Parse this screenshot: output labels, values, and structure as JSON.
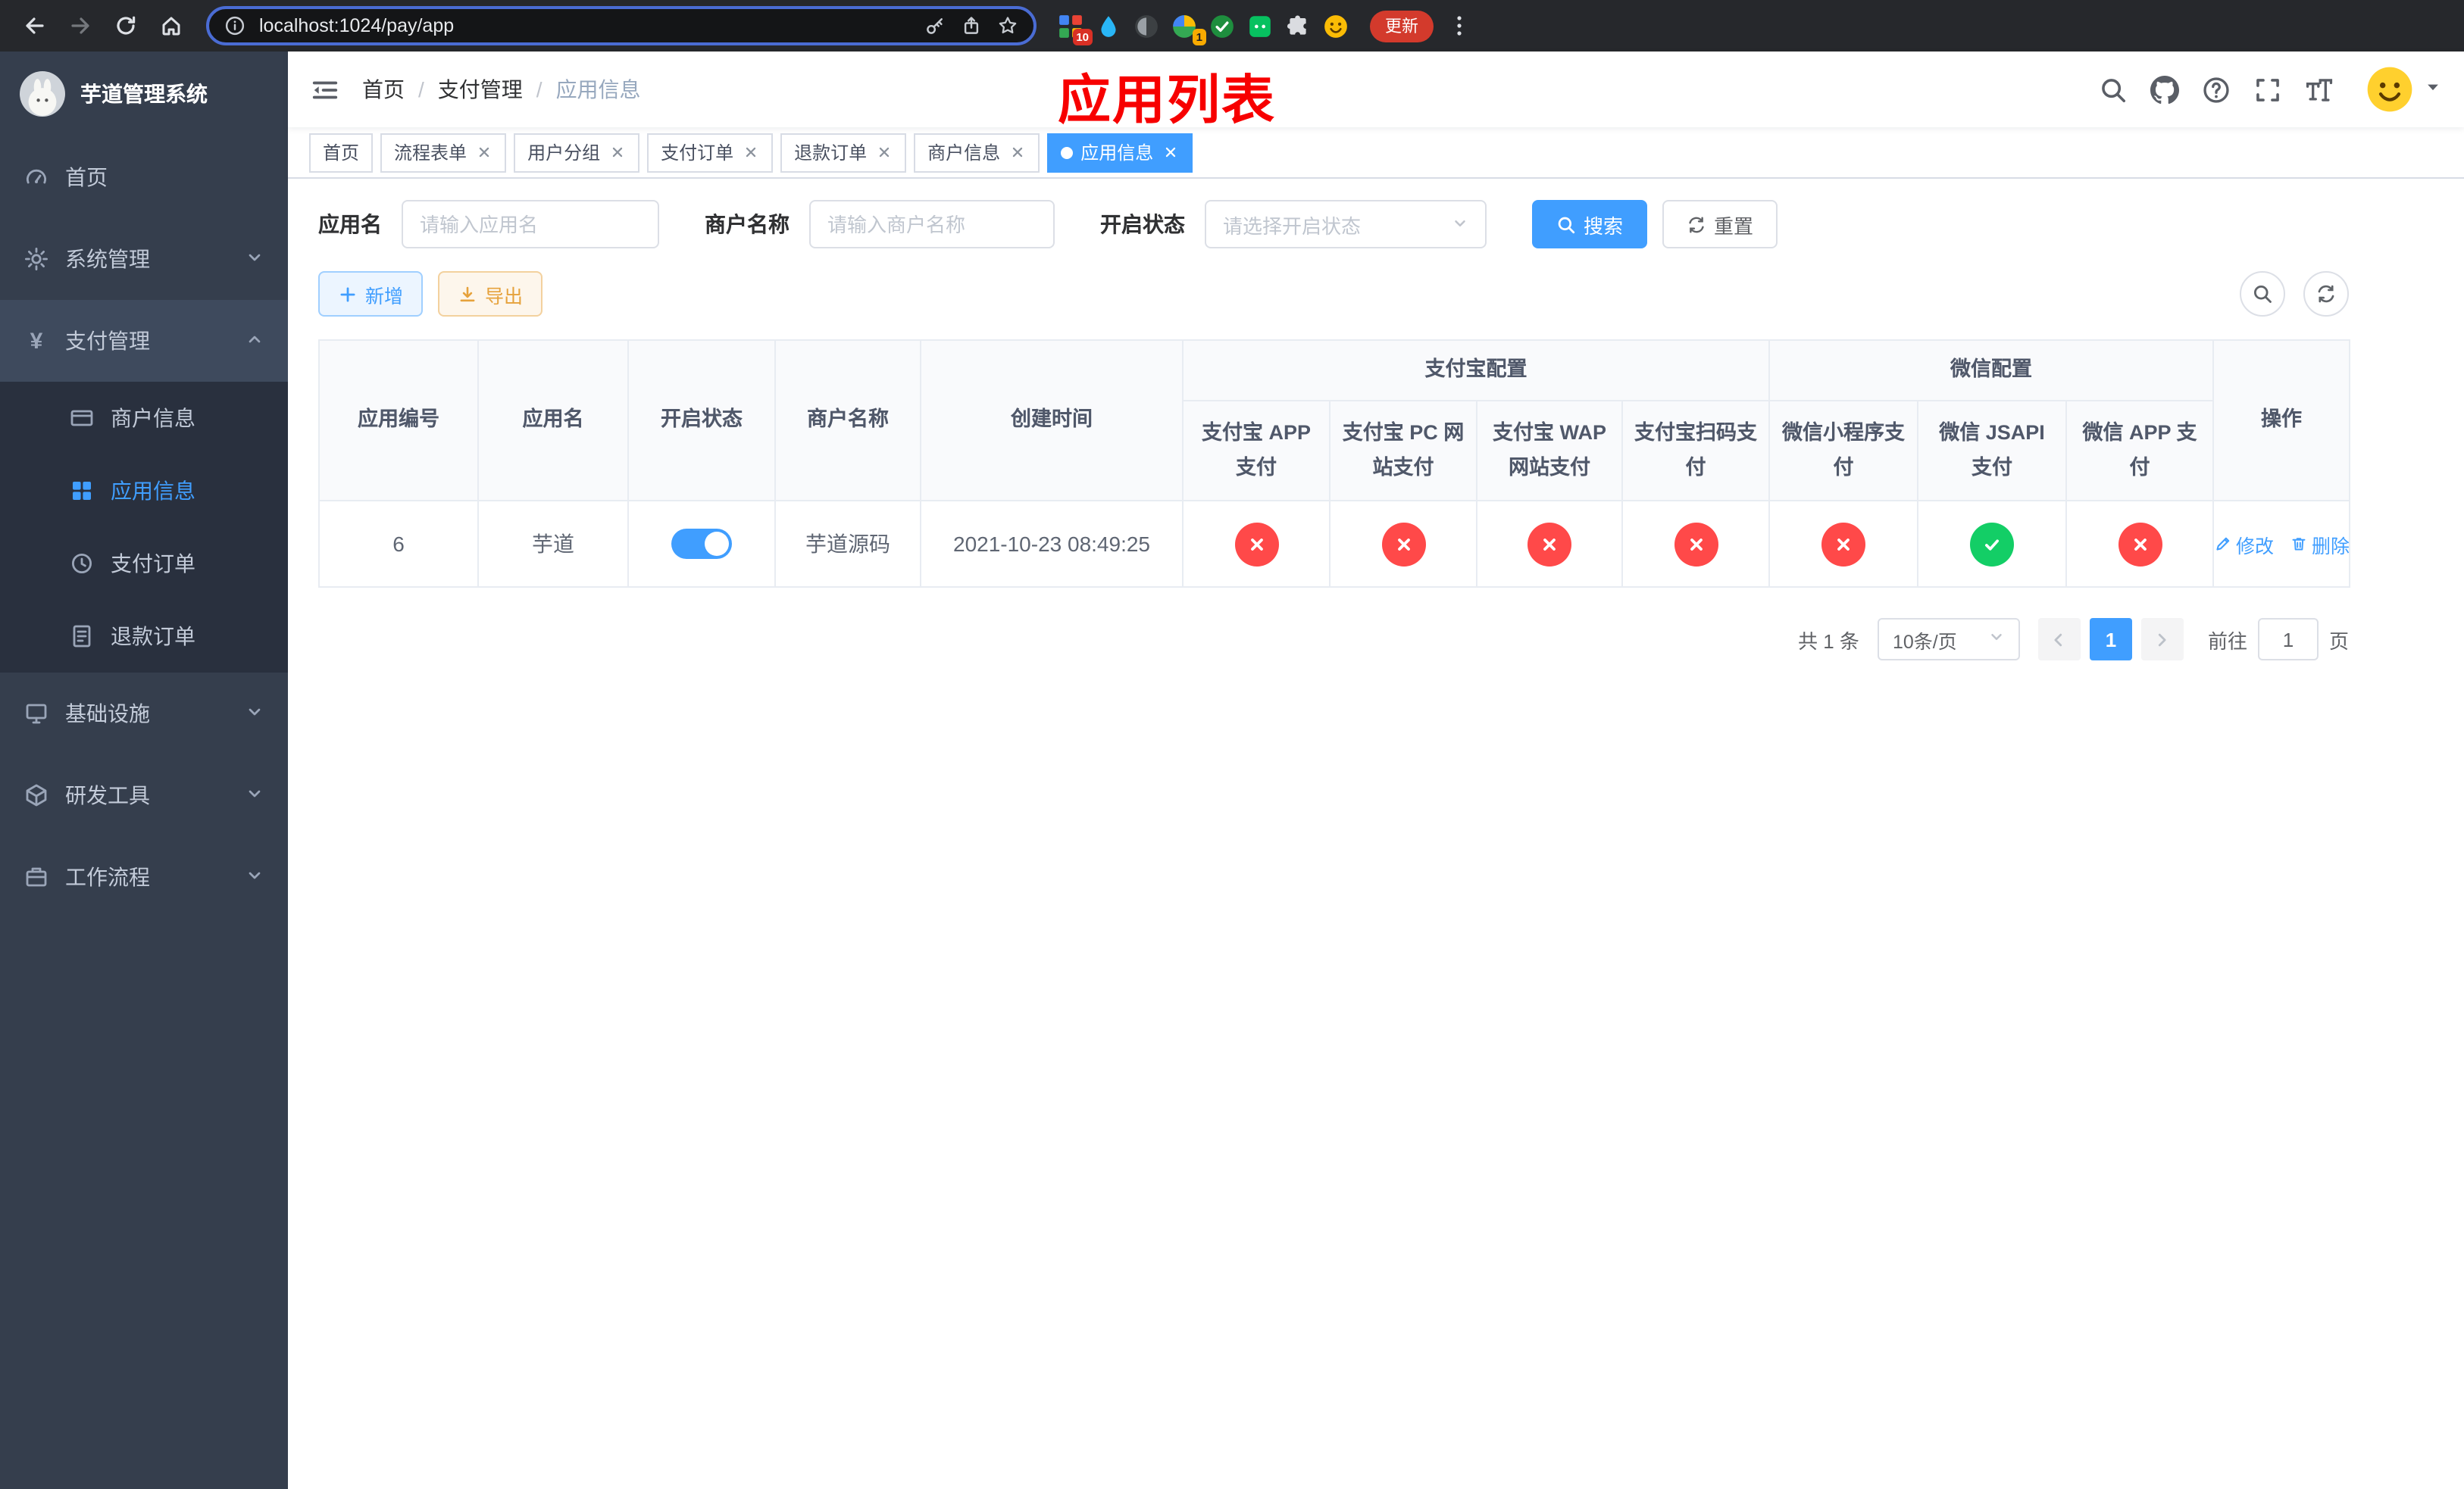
{
  "browser": {
    "url": "localhost:1024/pay/app",
    "update_label": "更新",
    "extension_badges": {
      "first": "10",
      "second": "1"
    }
  },
  "sidebar": {
    "title": "芋道管理系统",
    "items": [
      {
        "label": "首页"
      },
      {
        "label": "系统管理"
      },
      {
        "label": "支付管理"
      },
      {
        "label": "基础设施"
      },
      {
        "label": "研发工具"
      },
      {
        "label": "工作流程"
      }
    ],
    "payment_children": [
      {
        "label": "商户信息"
      },
      {
        "label": "应用信息",
        "active": true
      },
      {
        "label": "支付订单"
      },
      {
        "label": "退款订单"
      }
    ]
  },
  "navbar": {
    "breadcrumb": {
      "home": "首页",
      "section": "支付管理",
      "current": "应用信息"
    },
    "separator": "/",
    "overlay_title": "应用列表"
  },
  "tabs": {
    "items": [
      {
        "label": "首页",
        "closable": false,
        "active": false
      },
      {
        "label": "流程表单",
        "closable": true,
        "active": false
      },
      {
        "label": "用户分组",
        "closable": true,
        "active": false
      },
      {
        "label": "支付订单",
        "closable": true,
        "active": false
      },
      {
        "label": "退款订单",
        "closable": true,
        "active": false
      },
      {
        "label": "商户信息",
        "closable": true,
        "active": false
      },
      {
        "label": "应用信息",
        "closable": true,
        "active": true
      }
    ]
  },
  "filters": {
    "app_name_label": "应用名",
    "app_name_placeholder": "请输入应用名",
    "merchant_label": "商户名称",
    "merchant_placeholder": "请输入商户名称",
    "status_label": "开启状态",
    "status_placeholder": "请选择开启状态",
    "search_label": "搜索",
    "reset_label": "重置"
  },
  "toolbar": {
    "add_label": "新增",
    "export_label": "导出"
  },
  "table": {
    "col_id": "应用编号",
    "col_name": "应用名",
    "col_status": "开启状态",
    "col_merchant": "商户名称",
    "col_created": "创建时间",
    "group_alipay": "支付宝配置",
    "group_wechat": "微信配置",
    "col_alipay_app": "支付宝 APP 支付",
    "col_alipay_pc": "支付宝 PC 网站支付",
    "col_alipay_wap": "支付宝 WAP 网站支付",
    "col_alipay_qr": "支付宝扫码支付",
    "col_wx_mini": "微信小程序支付",
    "col_wx_jsapi": "微信 JSAPI 支付",
    "col_wx_app": "微信 APP 支付",
    "col_actions": "操作",
    "row": {
      "id": "6",
      "name": "芋道",
      "enabled": true,
      "merchant": "芋道源码",
      "created": "2021-10-23 08:49:25",
      "configs": {
        "alipay_app": false,
        "alipay_pc": false,
        "alipay_wap": false,
        "alipay_qr": false,
        "wx_mini": false,
        "wx_jsapi": true,
        "wx_app": false
      },
      "edit_label": "修改",
      "delete_label": "删除"
    }
  },
  "pagination": {
    "total": "共 1 条",
    "page_size": "10条/页",
    "current": "1",
    "goto_prefix": "前往",
    "goto_value": "1",
    "goto_suffix": "页"
  },
  "colors": {
    "primary": "#409eff",
    "success": "#13ce66",
    "danger": "#ff4949",
    "warning": "#e6a23c",
    "sidebar_bg": "#353e4d",
    "overlay_title": "#f70000"
  }
}
